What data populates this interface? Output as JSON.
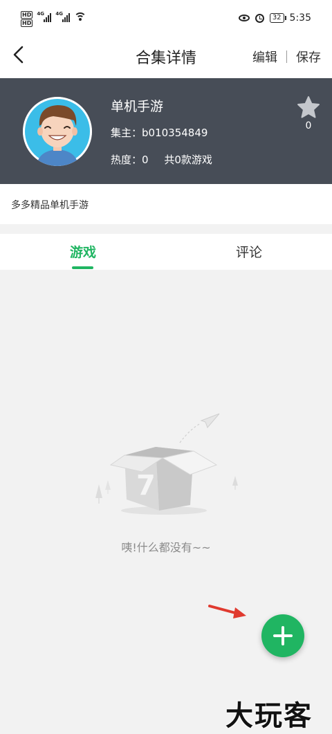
{
  "status_bar": {
    "hd1": "HD",
    "hd2": "HD",
    "net1": "4G",
    "net2": "4G",
    "battery": "32",
    "time": "5:35"
  },
  "nav": {
    "title": "合集详情",
    "edit_label": "编辑",
    "save_label": "保存"
  },
  "collection": {
    "name": "单机手游",
    "owner": "集主：b010354849",
    "heat": "热度：0",
    "games_count": "共0款游戏",
    "star_count": "0",
    "description": "多多精品单机手游"
  },
  "tabs": [
    {
      "label": "游戏",
      "active": true
    },
    {
      "label": "评论",
      "active": false
    }
  ],
  "empty_state": {
    "text": "咦!什么都没有~~"
  },
  "watermark": "大玩客",
  "colors": {
    "accent": "#20b562",
    "header_bg": "#474d57",
    "annotation_arrow": "#e03a2f"
  }
}
